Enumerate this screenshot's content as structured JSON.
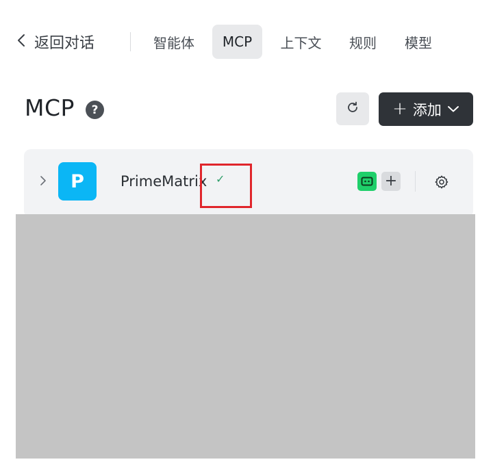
{
  "nav": {
    "back_label": "返回对话",
    "tabs": [
      {
        "label": "智能体",
        "active": false
      },
      {
        "label": "MCP",
        "active": true
      },
      {
        "label": "上下文",
        "active": false
      },
      {
        "label": "规则",
        "active": false
      },
      {
        "label": "模型",
        "active": false
      }
    ]
  },
  "header": {
    "title": "MCP",
    "help_glyph": "?",
    "add_plus": "+",
    "add_label": "添加"
  },
  "server": {
    "logo_letter": "P",
    "logo_color": "#0bb6f5",
    "name": "PrimeMatrix",
    "status_glyph": "✓",
    "status_color": "#2f9e6a",
    "more_tools_glyph": "+"
  },
  "colors": {
    "highlight": "#e0252b",
    "tool_icon": "#1fcf6a",
    "add_button_bg": "#2f3338"
  }
}
